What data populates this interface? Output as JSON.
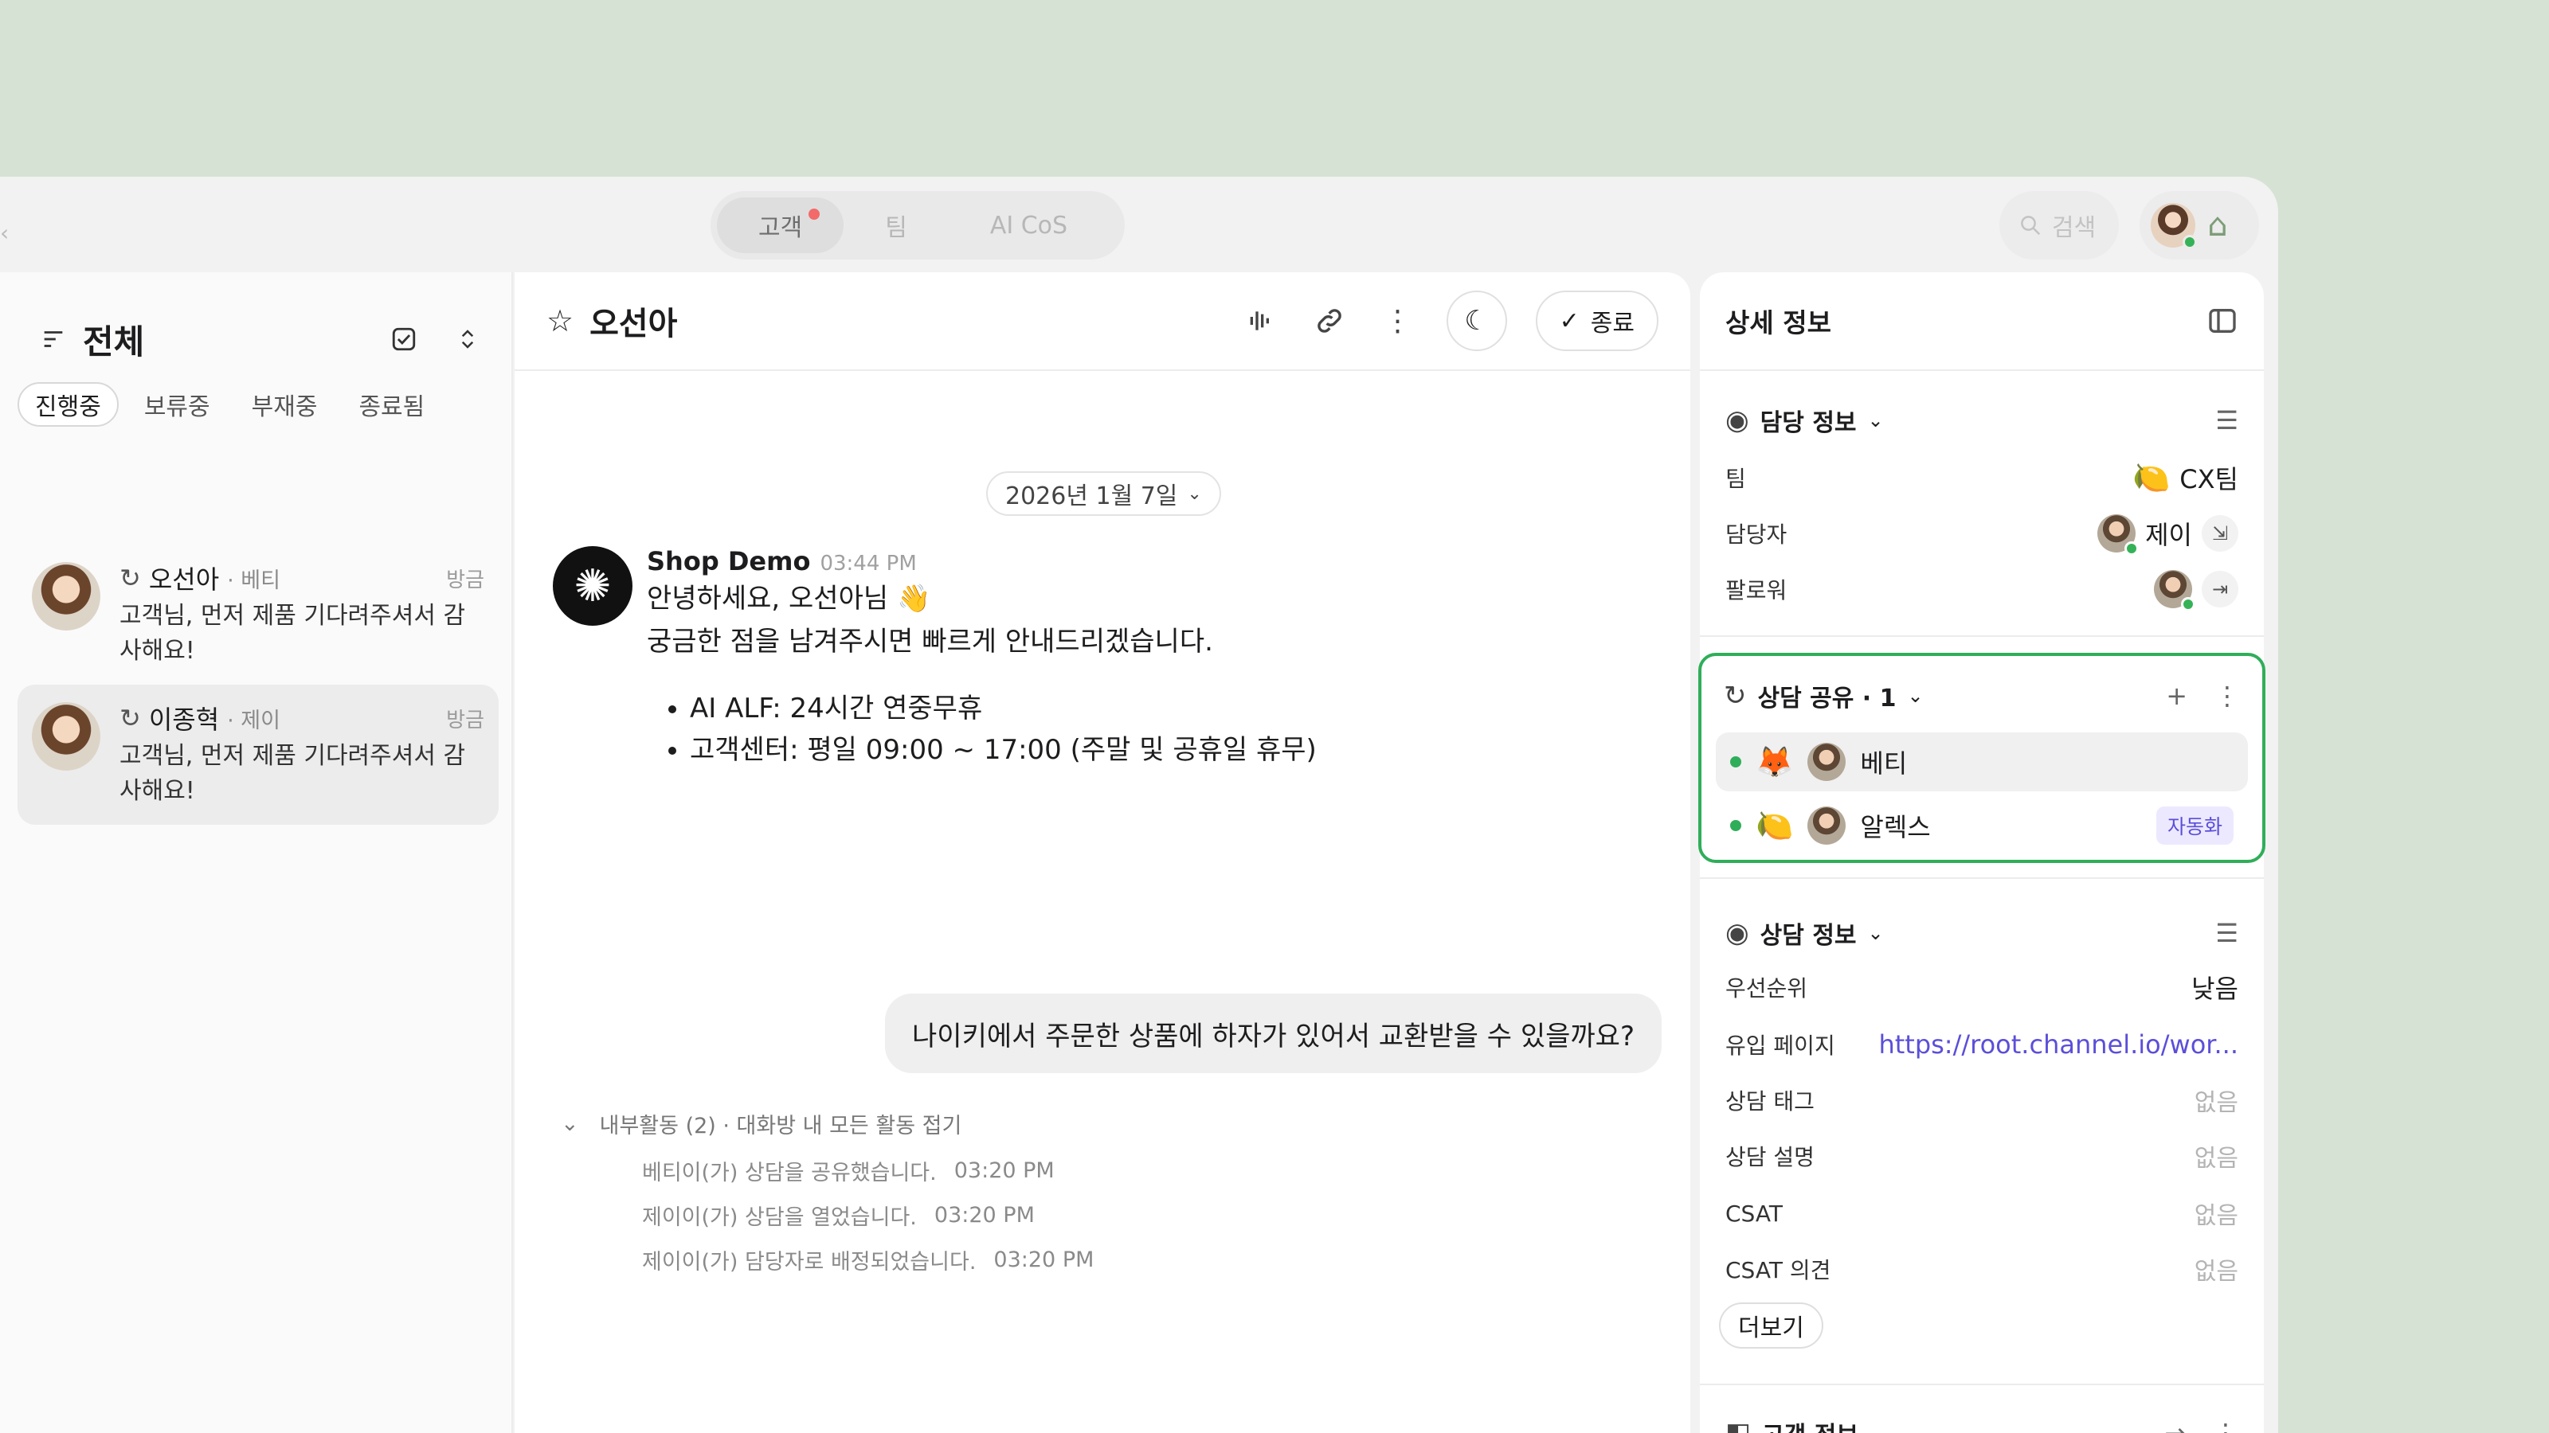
{
  "topbar": {
    "tabs": [
      {
        "label": "고객",
        "active": true,
        "has_dot": true
      },
      {
        "label": "팀",
        "active": false
      },
      {
        "label": "AI CoS",
        "active": false
      }
    ],
    "search_placeholder": "검색"
  },
  "left": {
    "title": "전체",
    "status_tabs": [
      "진행중",
      "보류중",
      "부재중",
      "종료됨"
    ],
    "conversations": [
      {
        "name": "오선아",
        "assignee": "· 베티",
        "time": "방금",
        "preview": "고객님, 먼저 제품 기다려주셔서 감사해요!"
      },
      {
        "name": "이종혁",
        "assignee": "· 제이",
        "time": "방금",
        "preview": "고객님, 먼저 제품 기다려주셔서 감사해요!"
      }
    ]
  },
  "chat": {
    "title": "오선아",
    "end_label": "종료",
    "date": "2026년 1월 7일",
    "message": {
      "sender": "Shop Demo",
      "time": "03:44 PM",
      "line1": "안녕하세요, 오선아님 👋",
      "line2": "궁금한 점을 남겨주시면 빠르게 안내드리겠습니다.",
      "bullets": [
        "AI ALF: 24시간 연중무휴",
        "고객센터: 평일 09:00 ~ 17:00 (주말 및 공휴일 휴무)"
      ]
    },
    "customer_message": "나이키에서 주문한 상품에 하자가 있어서 교환받을 수 있을까요?",
    "activity": {
      "header": "내부활동 (2) · 대화방 내 모든 활동 접기",
      "items": [
        {
          "text": "베티이(가) 상담을 공유했습니다.",
          "time": "03:20 PM"
        },
        {
          "text": "제이이(가) 상담을 열었습니다.",
          "time": "03:20 PM"
        },
        {
          "text": "제이이(가) 담당자로 배정되었습니다.",
          "time": "03:20 PM"
        }
      ]
    }
  },
  "details": {
    "title": "상세 정보",
    "assign": {
      "title": "담당 정보",
      "team_label": "팀",
      "team_value": "CX팀",
      "team_emoji": "🍋",
      "assignee_label": "담당자",
      "assignee_value": "제이",
      "follower_label": "팔로워"
    },
    "share": {
      "title": "상담 공유 · 1",
      "rows": [
        {
          "emoji": "🦊",
          "name": "베티",
          "badge": ""
        },
        {
          "emoji": "🍋",
          "name": "알렉스",
          "badge": "자동화"
        }
      ]
    },
    "consult": {
      "title": "상담 정보",
      "rows": [
        {
          "label": "우선순위",
          "value": "낮음",
          "kind": "plain"
        },
        {
          "label": "유입 페이지",
          "value": "https://root.channel.io/wor...",
          "kind": "link"
        },
        {
          "label": "상담 태그",
          "value": "없음",
          "kind": "muted"
        },
        {
          "label": "상담 설명",
          "value": "없음",
          "kind": "muted"
        },
        {
          "label": "CSAT",
          "value": "없음",
          "kind": "muted"
        },
        {
          "label": "CSAT 의견",
          "value": "없음",
          "kind": "muted"
        }
      ],
      "more_label": "더보기"
    },
    "customer_title": "고객 정보"
  },
  "colors": {
    "background": "#d6e3d4",
    "accent_green": "#2fae59",
    "link": "#5b4fd9",
    "tab_dot": "#f26a6a"
  }
}
